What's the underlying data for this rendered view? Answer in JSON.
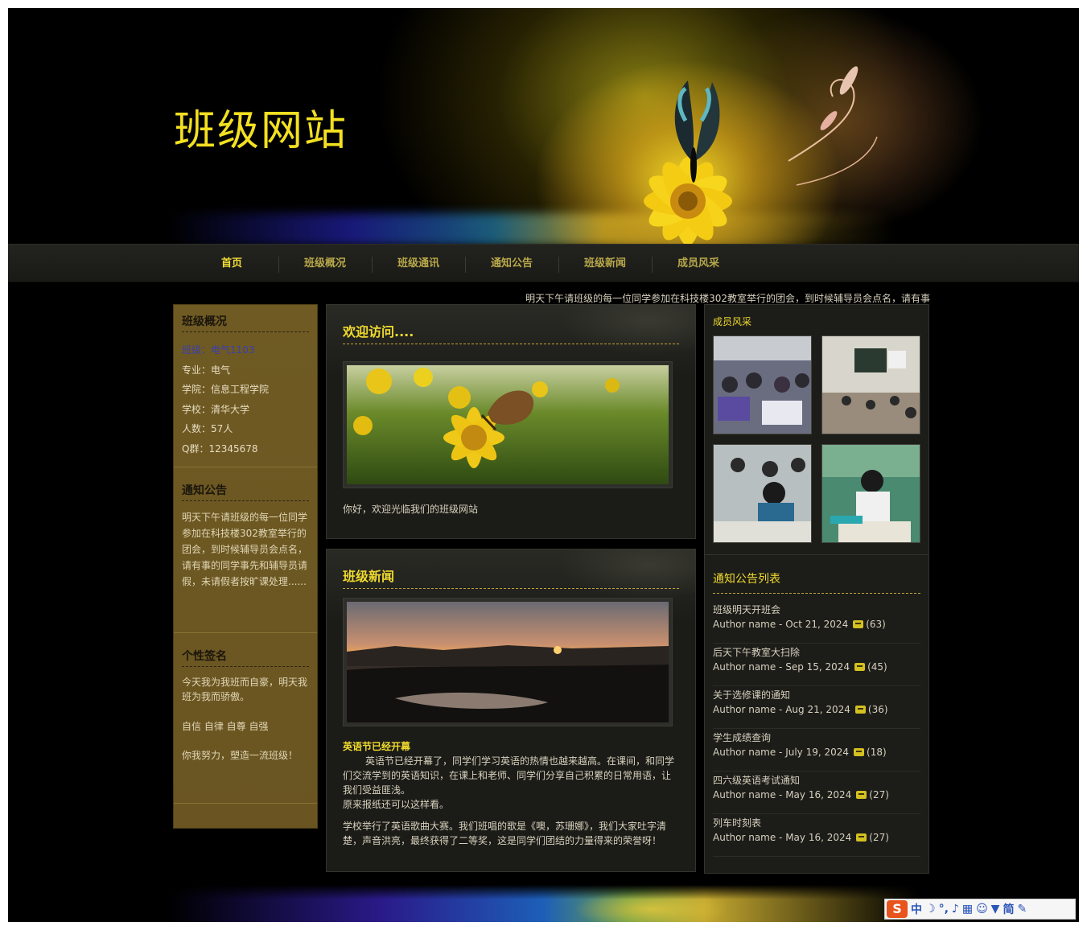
{
  "site": {
    "title": "班级网站"
  },
  "nav": {
    "items": [
      "首页",
      "班级概况",
      "班级通讯",
      "通知公告",
      "班级新闻",
      "成员风采"
    ],
    "active_index": 0
  },
  "marquee": {
    "text": "明天下午请班级的每一位同学参加在科技楼302教室举行的团会，到时候辅导员会点名，请有事"
  },
  "left": {
    "overview": {
      "title": "班级概况",
      "rows": [
        {
          "label": "班级：",
          "value": "电气1103"
        },
        {
          "label": "专业：",
          "value": "电气"
        },
        {
          "label": "学院：",
          "value": "信息工程学院"
        },
        {
          "label": "学校：",
          "value": "清华大学"
        },
        {
          "label": "人数：",
          "value": "57人"
        },
        {
          "label": "Q群：",
          "value": "12345678"
        }
      ]
    },
    "notice": {
      "title": "通知公告",
      "text": "明天下午请班级的每一位同学参加在科技楼302教室举行的团会，到时候辅导员会点名，请有事的同学事先和辅导员请假，未请假者按旷课处理......"
    },
    "signature": {
      "title": "个性签名",
      "lines": [
        "今天我为我班而自豪，明天我班为我而骄傲。",
        "自信 自律 自尊 自强",
        "你我努力，塑造一流班级！"
      ]
    }
  },
  "welcome": {
    "title": "欢迎访问....",
    "text": "你好，欢迎光临我们的班级网站"
  },
  "news": {
    "title": "班级新闻",
    "headline": "英语节已经开幕",
    "paragraph1": "英语节已经开幕了，同学们学习英语的热情也越来越高。在课间，和同学们交流学到的英语知识，在课上和老师、同学们分享自己积累的日常用语，让我们受益匪浅。",
    "paragraph1b": "原来报纸还可以这样看。",
    "paragraph2": "学校举行了英语歌曲大赛。我们班唱的歌是《噢，苏珊娜》，我们大家吐字清楚，声音洪亮，最终获得了二等奖，这是同学们团结的力量得来的荣誉呀！"
  },
  "right": {
    "members_title": "成员风采",
    "list_title": "通知公告列表",
    "notices": [
      {
        "title": "班级明天开班会",
        "meta": "Author name - Oct 21, 2024",
        "comments": "(63)"
      },
      {
        "title": "后天下午教室大扫除",
        "meta": "Author name - Sep 15, 2024",
        "comments": "(45)"
      },
      {
        "title": "关于选修课的通知",
        "meta": "Author name - Aug 21, 2024",
        "comments": "(36)"
      },
      {
        "title": "学生成绩查询",
        "meta": "Author name - July 19, 2024",
        "comments": "(18)"
      },
      {
        "title": "四六级英语考试通知",
        "meta": "Author name - May 16, 2024",
        "comments": "(27)"
      },
      {
        "title": "列车时刻表",
        "meta": "Author name - May 16, 2024",
        "comments": "(27)"
      }
    ]
  },
  "ime": {
    "logo": "S",
    "labels": [
      "中",
      "简"
    ]
  },
  "colors": {
    "accent": "#f0da2e",
    "sidebar": "#6f5a23",
    "panel": "#1b1b18"
  }
}
